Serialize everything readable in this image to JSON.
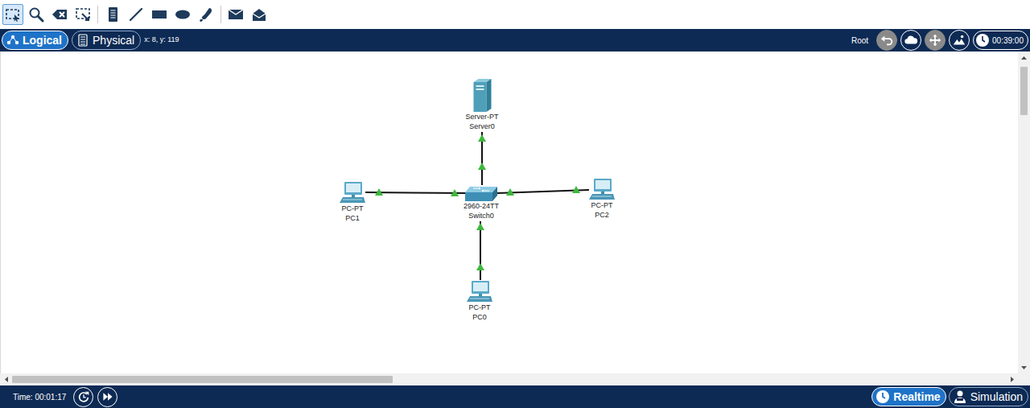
{
  "toolbar": {
    "tools": [
      {
        "selected": true
      },
      {
        "selected": false
      },
      {
        "selected": false
      },
      {
        "selected": false
      },
      {
        "selected": false
      },
      {
        "selected": false
      },
      {
        "selected": false
      },
      {
        "selected": false
      },
      {
        "selected": false
      },
      {
        "selected": false
      },
      {
        "selected": false
      }
    ]
  },
  "view_tabs": [
    {
      "label": "Logical",
      "selected": true
    },
    {
      "label": "Physical",
      "selected": false
    }
  ],
  "coordinates": "x: 8, y: 119",
  "workspace": {
    "label": "Root"
  },
  "clock": "00:39:00",
  "topology": {
    "devices": [
      {
        "model": "Server-PT",
        "name": "Server0",
        "kind": "server"
      },
      {
        "model": "2960-24TT",
        "name": "Switch0",
        "kind": "switch"
      },
      {
        "model": "PC-PT",
        "name": "PC1",
        "kind": "pc"
      },
      {
        "model": "PC-PT",
        "name": "PC2",
        "kind": "pc"
      },
      {
        "model": "PC-PT",
        "name": "PC0",
        "kind": "pc"
      }
    ],
    "links": [
      {
        "from": 0,
        "to": 1,
        "up": true
      },
      {
        "from": 1,
        "to": 2,
        "up": true
      },
      {
        "from": 1,
        "to": 3,
        "up": true
      },
      {
        "from": 1,
        "to": 4,
        "up": true
      }
    ]
  },
  "status_bar": {
    "time": "Time: 00:01:17",
    "modes": [
      {
        "label": "Realtime",
        "selected": true
      },
      {
        "label": "Simulation",
        "selected": false
      }
    ]
  }
}
